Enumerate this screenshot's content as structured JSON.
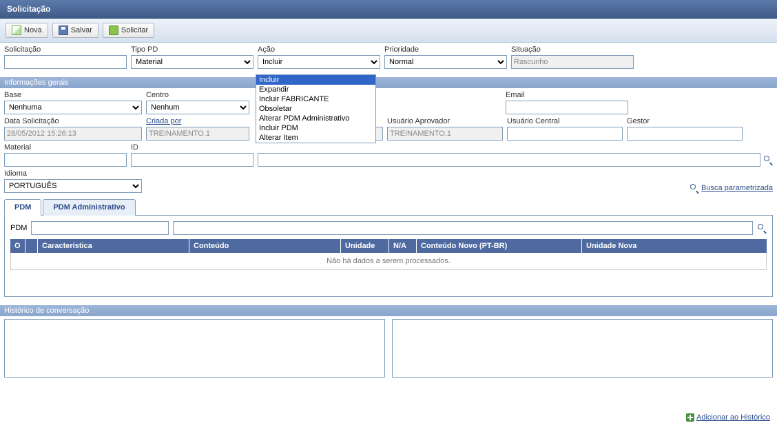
{
  "title": "Solicitação",
  "toolbar": {
    "nova": "Nova",
    "salvar": "Salvar",
    "solicitar": "Solicitar"
  },
  "topRow": {
    "solicitacao_label": "Solicitação",
    "solicitacao_value": "",
    "tipo_pd_label": "Tipo PD",
    "tipo_pd_value": "Material",
    "acao_label": "Ação",
    "acao_value": "Incluir",
    "acao_options": [
      "Incluir",
      "Expandir",
      "Incluir FABRICANTE",
      "Obsoletar",
      "Alterar PDM Administrativo",
      "Incluir PDM",
      "Alterar Item"
    ],
    "prioridade_label": "Prioridade",
    "prioridade_value": "Normal",
    "situacao_label": "Situação",
    "situacao_value": "Rascunho"
  },
  "sections": {
    "gerais": "Informações gerais",
    "historico": "Histórico de conversação"
  },
  "gerais": {
    "base_label": "Base",
    "base_value": "Nenhuma",
    "centro_label": "Centro",
    "centro_value": "Nenhum",
    "email_label": "Email",
    "email_value": "",
    "data_label": "Data Solicitação",
    "data_value": "28/05/2012 15:26:13",
    "criada_label": "Criada por",
    "criada_value": "TREINAMENTO.1",
    "aprov_label": "Usuário Aprovador",
    "aprov_value": "TREINAMENTO.1",
    "central_label": "Usuário Central",
    "central_value": "",
    "gestor_label": "Gestor",
    "gestor_value": "",
    "material_label": "Material",
    "material_value": "",
    "id_label": "ID",
    "id_value": "",
    "idioma_label": "Idioma",
    "idioma_value": "PORTUGUÊS"
  },
  "busca_link": "Busca parametrizada",
  "tabs": {
    "pdm": "PDM",
    "pdm_admin": "PDM Administrativo"
  },
  "pdm_panel": {
    "label": "PDM",
    "grid": {
      "col_o": "O",
      "col_car": "Característica",
      "col_cont": "Conteúdo",
      "col_uni": "Unidade",
      "col_na": "N/A",
      "col_cnovo": "Conteúdo Novo (PT-BR)",
      "col_unova": "Unidade Nova",
      "empty": "Não há dados a serem processados."
    }
  },
  "bottom_link": "Adicionar ao Histórico"
}
